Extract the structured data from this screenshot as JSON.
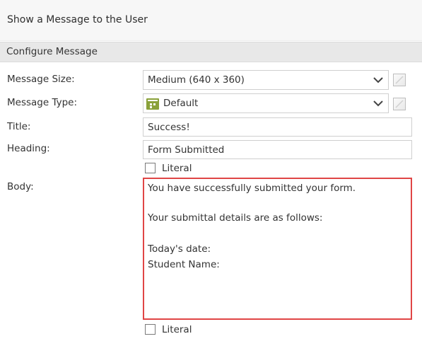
{
  "header": {
    "title": "Show a Message to the User"
  },
  "section": {
    "label": "Configure Message"
  },
  "form": {
    "message_size": {
      "label": "Message Size:",
      "value": "Medium (640 x 360)"
    },
    "message_type": {
      "label": "Message Type:",
      "value": "Default"
    },
    "title": {
      "label": "Title:",
      "value": "Success!"
    },
    "heading": {
      "label": "Heading:",
      "value": "Form Submitted",
      "literal_label": "Literal",
      "literal_checked": false
    },
    "body": {
      "label": "Body:",
      "lines": [
        "You have successfully submitted your form.",
        "",
        "Your submittal details are as follows:",
        "",
        "Today's date:",
        "Student Name:"
      ],
      "literal_label": "Literal",
      "literal_checked": false
    }
  },
  "icons": {
    "dropdown": "chevron-down-icon",
    "edit_toggle": "edit-square-icon",
    "message_type": "calendar-grid-icon"
  },
  "colors": {
    "highlight_border": "#e04545",
    "type_icon": "#8aa13a"
  }
}
